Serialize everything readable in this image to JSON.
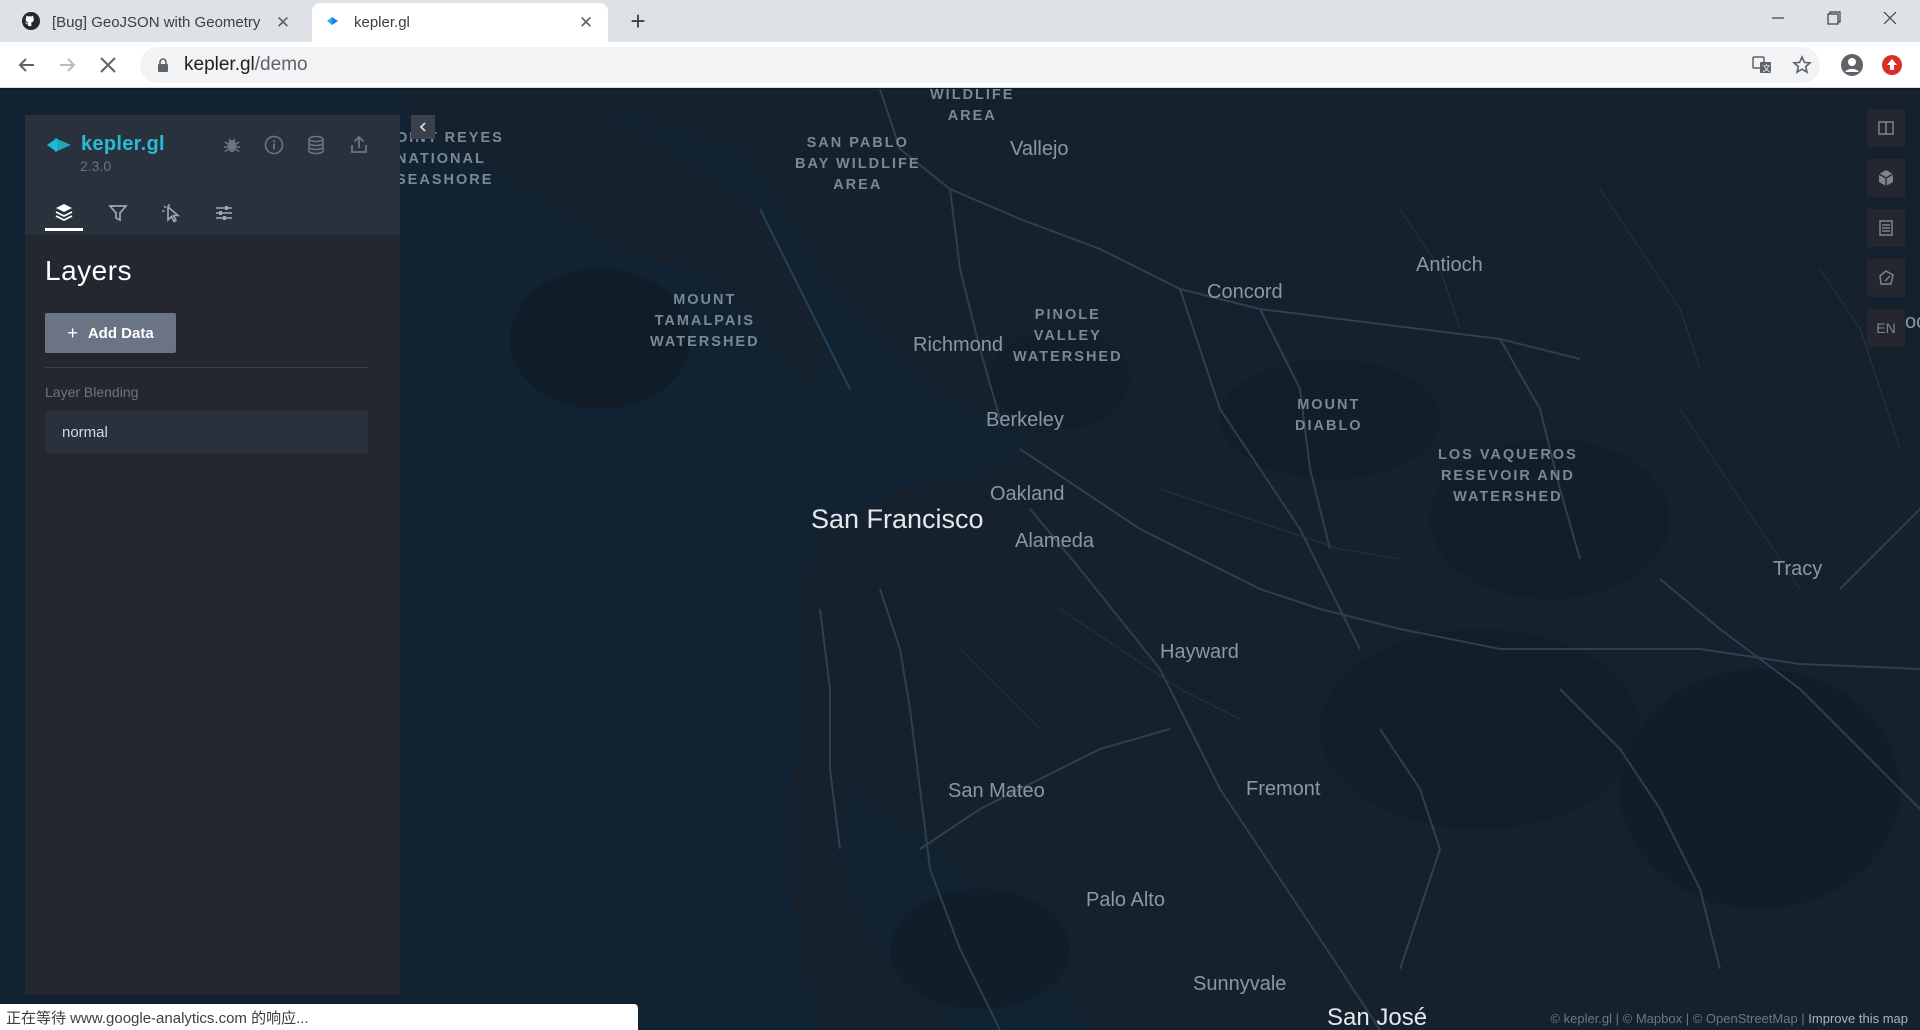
{
  "browser": {
    "tabs": [
      {
        "title": "[Bug] GeoJSON with Geometry",
        "icon": "github-icon",
        "active": false
      },
      {
        "title": "kepler.gl",
        "icon": "kepler-favicon",
        "active": true
      }
    ],
    "address": {
      "host": "kepler.gl",
      "path": "/demo"
    },
    "status_text": "正在等待 www.google-analytics.com 的响应..."
  },
  "panel": {
    "app_name": "kepler.gl",
    "version": "2.3.0",
    "title": "Layers",
    "add_data_label": "Add Data",
    "layer_blending_label": "Layer Blending",
    "layer_blending_value": "normal",
    "tabs": [
      "layers",
      "filters",
      "interactions",
      "map-style"
    ]
  },
  "map": {
    "language_button": "EN",
    "attribution": {
      "kepler": "© kepler.gl",
      "mapbox": "© Mapbox",
      "osm": "© OpenStreetMap",
      "improve": "Improve this map"
    },
    "places": {
      "san_francisco": "San Francisco",
      "vallejo": "Vallejo",
      "antioch": "Antioch",
      "concord": "Concord",
      "richmond": "Richmond",
      "berkeley": "Berkeley",
      "oakland": "Oakland",
      "alameda": "Alameda",
      "tracy": "Tracy",
      "hayward": "Hayward",
      "san_mateo": "San Mateo",
      "fremont": "Fremont",
      "palo_alto": "Palo Alto",
      "sunnyvale": "Sunnyvale",
      "san_jose": "San José",
      "wildlife_area_1": "WILDLIFE",
      "wildlife_area_2": "AREA",
      "point_reyes_1": "OINT REYES",
      "point_reyes_2": "NATIONAL",
      "point_reyes_3": "SEASHORE",
      "san_pablo_1": "SAN PABLO",
      "san_pablo_2": "BAY WILDLIFE",
      "san_pablo_3": "AREA",
      "tamalpais_1": "MOUNT",
      "tamalpais_2": "TAMALPAIS",
      "tamalpais_3": "WATERSHED",
      "pinole_1": "PINOLE",
      "pinole_2": "VALLEY",
      "pinole_3": "WATERSHED",
      "diablo_1": "MOUNT",
      "diablo_2": "DIABLO",
      "vaqueros_1": "LOS VAQUEROS",
      "vaqueros_2": "RESEVOIR AND",
      "vaqueros_3": "WATERSHED",
      "edge_fragment": "oc"
    }
  },
  "colors": {
    "water": "#112233",
    "land": "#16232f",
    "road": "#2b4050",
    "panel_bg": "#242730",
    "panel_header": "#29323c",
    "accent": "#29bbd6"
  }
}
